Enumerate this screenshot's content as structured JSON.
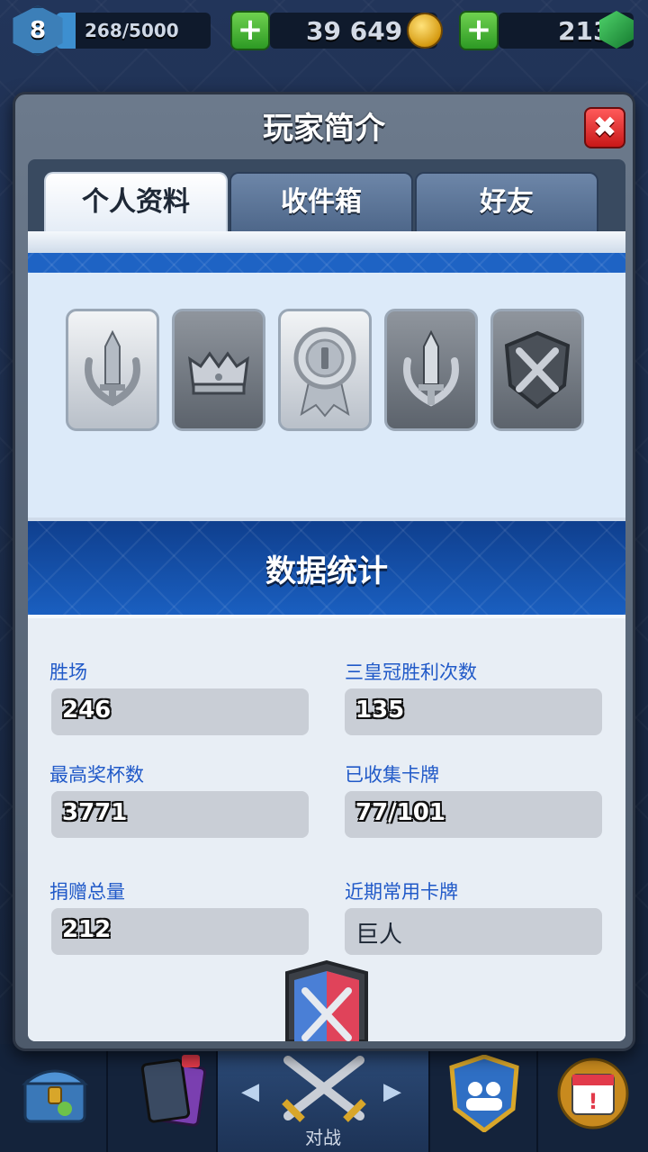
{
  "topbar": {
    "level": "8",
    "xp_text": "268/5000",
    "xp_fraction": 0.054,
    "gold": "39 649",
    "gems": "213"
  },
  "modal": {
    "title": "玩家简介",
    "close_label": "✖",
    "tabs": [
      {
        "label": "个人资料",
        "active": true
      },
      {
        "label": "收件箱",
        "active": false
      },
      {
        "label": "好友",
        "active": false
      }
    ],
    "badges": [
      {
        "icon": "sword-laurel-badge-icon",
        "style": "light"
      },
      {
        "icon": "crown-badge-icon",
        "style": "dark"
      },
      {
        "icon": "medal-ribbon-badge-icon",
        "style": "light"
      },
      {
        "icon": "sword-laurel-dark-badge-icon",
        "style": "dark"
      },
      {
        "icon": "crossed-swords-shield-badge-icon",
        "style": "dark"
      }
    ],
    "stats_title": "数据统计",
    "stats": {
      "wins_label": "胜场",
      "wins_value": "246",
      "three_crown_label": "三皇冠胜利次数",
      "three_crown_value": "135",
      "highest_trophies_label": "最高奖杯数",
      "highest_trophies_value": "3771",
      "cards_found_label": "已收集卡牌",
      "cards_found_value": "77/101",
      "total_donations_label": "捐赠总量",
      "total_donations_value": "212",
      "favorite_card_label": "近期常用卡牌",
      "favorite_card_value": "巨人"
    }
  },
  "bottomnav": {
    "battle_label": "对战"
  },
  "colors": {
    "accent_blue": "#2059c8",
    "close_red": "#e02424",
    "plus_green": "#3fae2e"
  }
}
